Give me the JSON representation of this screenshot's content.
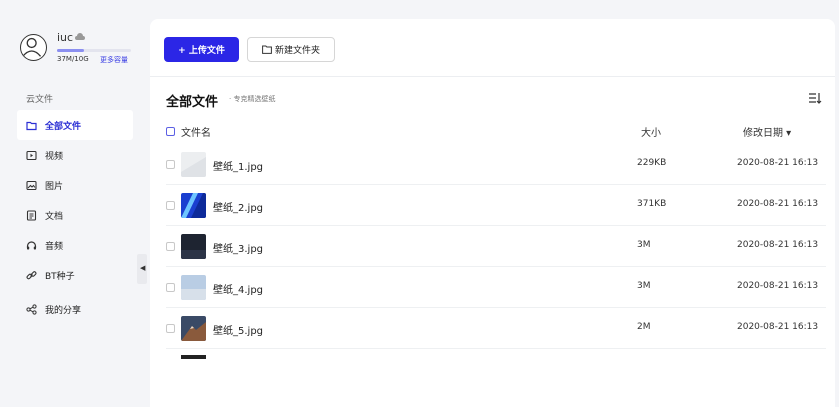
{
  "user": {
    "name": "iuc",
    "quota_text": "37M/10G",
    "quota_fraction": 0.37,
    "more_storage": "更多容量",
    "accent": "#2b26e6"
  },
  "sidebar": {
    "section": "云文件",
    "items": [
      {
        "label": "全部文件",
        "icon": "folder-icon",
        "active": true
      },
      {
        "label": "视频",
        "icon": "video-icon",
        "active": false
      },
      {
        "label": "图片",
        "icon": "image-icon",
        "active": false
      },
      {
        "label": "文档",
        "icon": "document-icon",
        "active": false
      },
      {
        "label": "音频",
        "icon": "headphones-icon",
        "active": false
      },
      {
        "label": "BT种子",
        "icon": "link-icon",
        "active": false
      },
      {
        "label": "我的分享",
        "icon": "share-icon",
        "active": false
      }
    ]
  },
  "toolbar": {
    "upload_label": "+ 上传文件",
    "new_folder_label": "新建文件夹"
  },
  "main": {
    "title": "全部文件",
    "subtitle": "· 专克精选壁纸"
  },
  "table": {
    "headers": {
      "name": "文件名",
      "size": "大小",
      "date": "修改日期 ▾"
    },
    "rows": [
      {
        "name": "壁纸_1.jpg",
        "size": "229KB",
        "date": "2020-08-21 16:13",
        "thumb": "light"
      },
      {
        "name": "壁纸_2.jpg",
        "size": "371KB",
        "date": "2020-08-21 16:13",
        "thumb": "blue"
      },
      {
        "name": "壁纸_3.jpg",
        "size": "3M",
        "date": "2020-08-21 16:13",
        "thumb": "dark"
      },
      {
        "name": "壁纸_4.jpg",
        "size": "3M",
        "date": "2020-08-21 16:13",
        "thumb": "sky"
      },
      {
        "name": "壁纸_5.jpg",
        "size": "2M",
        "date": "2020-08-21 16:13",
        "thumb": "mountain"
      }
    ]
  }
}
